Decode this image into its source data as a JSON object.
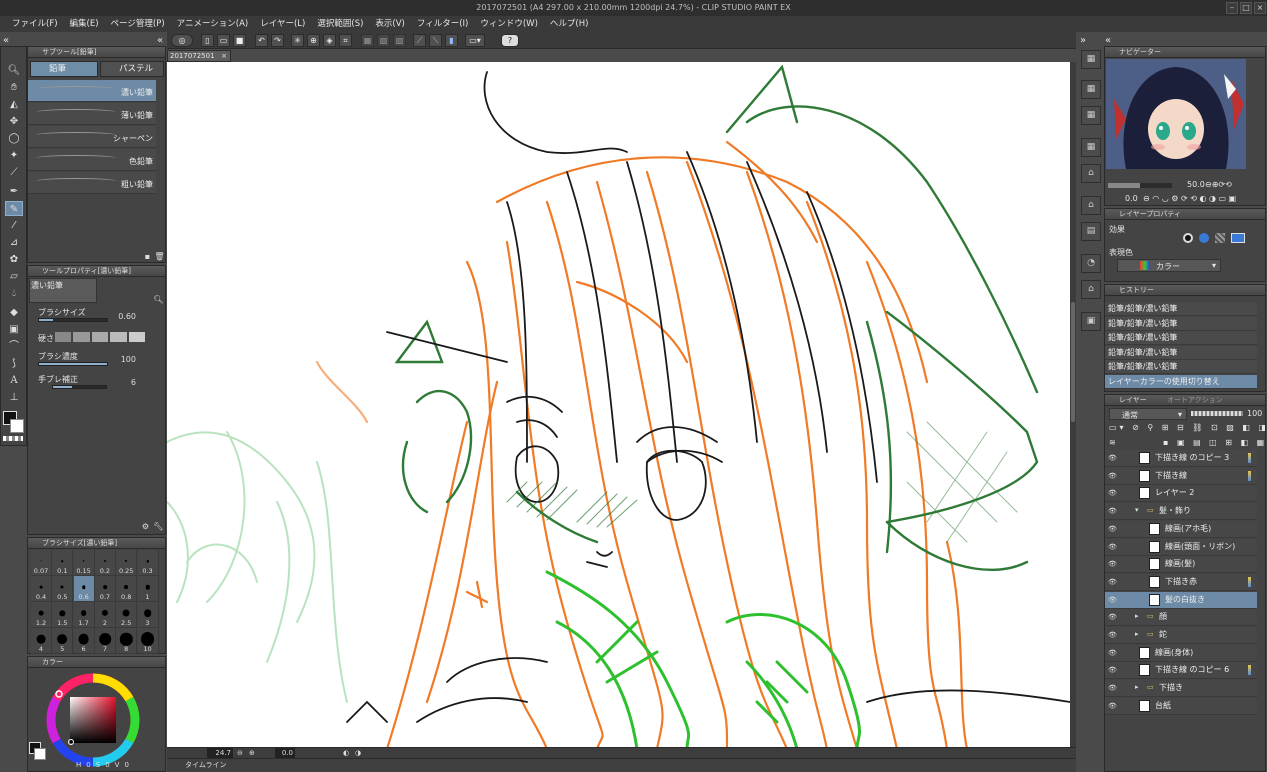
{
  "window": {
    "title": "2017072501 (A4 297.00 x 210.00mm 1200dpi 24.7%)  - CLIP STUDIO PAINT EX"
  },
  "menu": [
    "ファイル(F)",
    "編集(E)",
    "ページ管理(P)",
    "アニメーション(A)",
    "レイヤー(L)",
    "選択範囲(S)",
    "表示(V)",
    "フィルター(I)",
    "ウィンドウ(W)",
    "ヘルプ(H)"
  ],
  "document_tab": "2017072501",
  "subtool": {
    "header": "サブツール[鉛筆]",
    "tabs": [
      "鉛筆",
      "パステル"
    ],
    "brushes": [
      "濃い鉛筆",
      "薄い鉛筆",
      "シャーペン",
      "色鉛筆",
      "粗い鉛筆"
    ]
  },
  "tool_property": {
    "header": "ツールプロパティ[濃い鉛筆]",
    "current": "濃い鉛筆",
    "brush_size_label": "ブラシサイズ",
    "brush_size_value": "0.60",
    "brush_size_level": 0.2,
    "hardness_label": "硬さ",
    "density_label": "ブラシ濃度",
    "density_value": "100",
    "density_level": 1.0,
    "stabilization_label": "手ブレ補正",
    "stabilization_value": "6",
    "stabilization_level": 0.35
  },
  "brush_size_panel": {
    "header": "ブラシサイズ[濃い鉛筆]",
    "sizes": [
      "0.07",
      "0.1",
      "0.15",
      "0.2",
      "0.25",
      "0.3",
      "0.4",
      "0.5",
      "0.6",
      "0.7",
      "0.8",
      "1",
      "1.2",
      "1.5",
      "1.7",
      "2",
      "2.5",
      "3",
      "4",
      "5",
      "6",
      "7",
      "8",
      "10"
    ],
    "active": "0.6"
  },
  "color_panel": {
    "header": "カラー",
    "readout": [
      "H",
      "0",
      "S",
      "0",
      "V",
      "0"
    ]
  },
  "navigator": {
    "header": "ナビゲーター",
    "zoom": "50.0",
    "rotation": "0.0"
  },
  "layer_property": {
    "header": "レイヤープロパティ",
    "effect_label": "効果",
    "expression_color_label": "表現色",
    "expression_color_value": "カラー"
  },
  "history": {
    "header": "ヒストリー",
    "items": [
      "鉛筆/鉛筆/濃い鉛筆",
      "鉛筆/鉛筆/濃い鉛筆",
      "鉛筆/鉛筆/濃い鉛筆",
      "鉛筆/鉛筆/濃い鉛筆",
      "鉛筆/鉛筆/濃い鉛筆",
      "レイヤーカラーの使用切り替え"
    ]
  },
  "layers": {
    "header": "レイヤー",
    "header_tab2": "オートアクション",
    "blend_mode": "通常",
    "opacity": "100",
    "items": [
      {
        "name": "下描き線 のコピー 3",
        "indent": 1,
        "type": "raster",
        "flag": true
      },
      {
        "name": "下描き線",
        "indent": 1,
        "type": "raster",
        "flag": true
      },
      {
        "name": "レイヤー 2",
        "indent": 1,
        "type": "raster"
      },
      {
        "name": "髪・飾り",
        "indent": 1,
        "type": "folder",
        "open": true
      },
      {
        "name": "線画(アホ毛)",
        "indent": 2,
        "type": "raster"
      },
      {
        "name": "線画(頭面・リボン)",
        "indent": 2,
        "type": "raster"
      },
      {
        "name": "線画(髪)",
        "indent": 2,
        "type": "raster"
      },
      {
        "name": "下描き赤",
        "indent": 2,
        "type": "raster",
        "flag": true
      },
      {
        "name": "髪の白抜き",
        "indent": 2,
        "type": "raster",
        "active": true
      },
      {
        "name": "顔",
        "indent": 1,
        "type": "folder"
      },
      {
        "name": "鉈",
        "indent": 1,
        "type": "folder"
      },
      {
        "name": "線画(身体)",
        "indent": 1,
        "type": "raster"
      },
      {
        "name": "下描き線 のコピー 6",
        "indent": 1,
        "type": "raster",
        "flag": true
      },
      {
        "name": "下描き",
        "indent": 1,
        "type": "folder"
      },
      {
        "name": "台紙",
        "indent": 1,
        "type": "paper"
      }
    ]
  },
  "status": {
    "zoom": "24.7",
    "angle": "0.0"
  },
  "timeline": "タイムライン",
  "colors": {
    "bg": "#4a4a4a",
    "accent": "#6d8aa6",
    "sketch_orange": "#f07a25",
    "sketch_green": "#2e7a36",
    "sketch_bright_green": "#2fc030",
    "line_black": "#1a1a1a"
  }
}
